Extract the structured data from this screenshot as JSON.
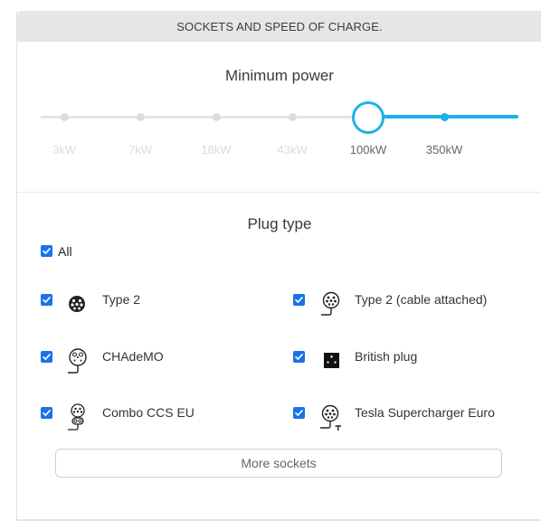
{
  "header": {
    "title": "SOCKETS AND SPEED OF CHARGE."
  },
  "power": {
    "title": "Minimum power",
    "stops": [
      "3kW",
      "7kW",
      "18kW",
      "43kW",
      "100kW",
      "350kW"
    ],
    "selected_index": 4,
    "accent_color": "#1db1e7"
  },
  "plugs": {
    "title": "Plug type",
    "all": {
      "label": "All",
      "checked": true
    },
    "items": [
      {
        "label": "Type 2",
        "icon": "type2-socket-icon",
        "checked": true
      },
      {
        "label": "Type 2 (cable attached)",
        "icon": "type2-cable-icon",
        "checked": true
      },
      {
        "label": "CHAdeMO",
        "icon": "chademo-plug-icon",
        "checked": true
      },
      {
        "label": "British plug",
        "icon": "british-plug-icon",
        "checked": true
      },
      {
        "label": "Combo CCS EU",
        "icon": "ccs-combo-icon",
        "checked": true
      },
      {
        "label": "Tesla Supercharger Euro",
        "icon": "tesla-supercharger-icon",
        "checked": true
      }
    ],
    "checkbox_color": "#1a73e8"
  },
  "more_button": {
    "label": "More sockets"
  }
}
